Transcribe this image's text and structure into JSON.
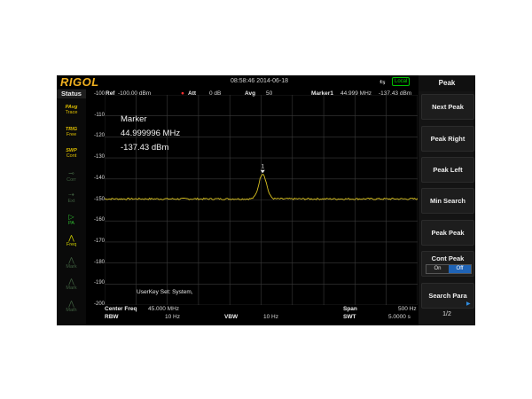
{
  "header": {
    "logo": "RIGOL",
    "datetime": "08:58:46 2014-06-18",
    "local": "Local",
    "ref_label": "Ref",
    "ref_value": "-100.00 dBm",
    "att_label": "Att",
    "att_value": "0 dB",
    "avg_label": "Avg",
    "avg_value": "50",
    "marker_label": "Marker1",
    "marker_freq": "44.999 MHz",
    "marker_amp": "-137.43 dBm"
  },
  "status": {
    "title": "Status",
    "items": [
      {
        "top": "PAvg",
        "label": "Trace",
        "icon": "trace-icon",
        "color": "#e0c000",
        "active": true
      },
      {
        "top": "TRIG",
        "label": "Free",
        "icon": "trig-icon",
        "color": "#e0c000",
        "active": true
      },
      {
        "top": "SWP",
        "label": "Cont",
        "icon": "sweep-icon",
        "color": "#e0c000",
        "active": true
      },
      {
        "top": "",
        "label": "Corr",
        "icon": "corr-icon",
        "color": "#406040",
        "active": false
      },
      {
        "top": "",
        "label": "Ext",
        "icon": "ext-icon",
        "color": "#406040",
        "active": false
      },
      {
        "top": "",
        "label": "PA",
        "icon": "preamp-icon",
        "color": "#30c030",
        "active": true
      },
      {
        "top": "",
        "label": "Freq",
        "icon": "freq-icon",
        "color": "#d0d000",
        "active": true
      },
      {
        "top": "",
        "label": "Mark",
        "icon": "mark-icon",
        "color": "#406040",
        "active": false
      },
      {
        "top": "",
        "label": "Mark",
        "icon": "mark2-icon",
        "color": "#406040",
        "active": false
      },
      {
        "top": "",
        "label": "Math",
        "icon": "math-icon",
        "color": "#406040",
        "active": false
      }
    ]
  },
  "axis": {
    "y_ticks": [
      "-100",
      "-110",
      "-120",
      "-130",
      "-140",
      "-150",
      "-160",
      "-170",
      "-180",
      "-190",
      "-200"
    ]
  },
  "marker_readout": {
    "title": "Marker",
    "freq": "44.999996 MHz",
    "amp": "-137.43 dBm",
    "number": "1"
  },
  "userkey": "UserKey Set:   System,",
  "footer": {
    "center_freq_label": "Center Freq",
    "center_freq_value": "45.000 MHz",
    "span_label": "Span",
    "span_value": "500 Hz",
    "rbw_label": "RBW",
    "rbw_value": "10 Hz",
    "vbw_label": "VBW",
    "vbw_value": "10 Hz",
    "swt_label": "SWT",
    "swt_value": "5.0000 s"
  },
  "menu": {
    "title": "Peak",
    "next_peak": "Next Peak",
    "peak_right": "Peak Right",
    "peak_left": "Peak Left",
    "min_search": "Min Search",
    "peak_peak": "Peak Peak",
    "cont_peak": "Cont Peak",
    "on": "On",
    "off": "Off",
    "search_para": "Search Para",
    "page": "1/2"
  },
  "colors": {
    "trace": "#d8c020",
    "grid": "#3a3a3a",
    "selected": "#1f63b5"
  },
  "trace": {
    "y_top": -100,
    "y_bottom": -200,
    "noise_floor": -149.5,
    "peak_pos": 0.505,
    "peak_level": -137.43
  }
}
